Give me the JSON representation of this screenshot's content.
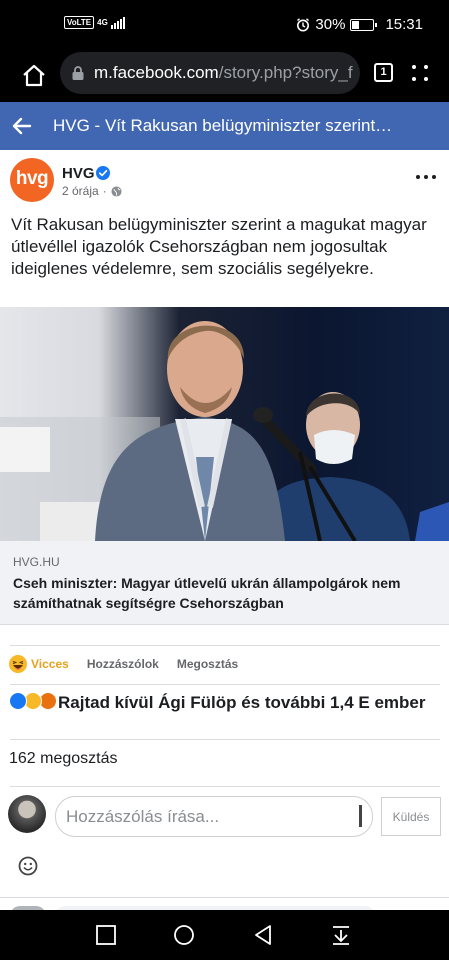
{
  "status_bar": {
    "volte": "VoLTE",
    "network": "4G",
    "battery": "30%",
    "time": "15:31"
  },
  "browser": {
    "url_host": "m.facebook.com",
    "url_path": "/story.php?story_f",
    "tab_count": "1"
  },
  "header": {
    "title": "HVG - Vít Rakusan belügyminiszter szerint…"
  },
  "post": {
    "avatar_text": "hvg",
    "page_name": "HVG",
    "time": "2 órája",
    "separator": "·",
    "text": "Vít Rakusan belügyminiszter szerint a magukat magyar útlevéllel igazolók Csehországban nem jogosultak ideiglenes védelemre, sem szociális segélyekre.",
    "link_domain": "HVG.HU",
    "link_title": "Cseh miniszter: Magyar útlevelű ukrán állampolgárok nem számíthatnak segítségre Csehországban"
  },
  "actions": {
    "reaction": "Vicces",
    "comment": "Hozzászólok",
    "share": "Megosztás"
  },
  "reactions_summary": "Rajtad kívül Ági Fülöp és további 1,4 E ember",
  "shares": "162 megosztás",
  "comment_box": {
    "placeholder": "Hozzászólás írása...",
    "send": "Küldés"
  },
  "icons": {
    "brand_color": "#4267b2",
    "hvg_color": "#f26522"
  }
}
